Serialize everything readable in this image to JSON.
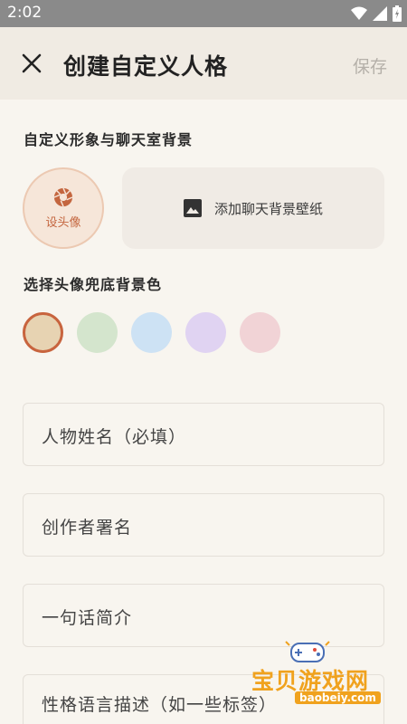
{
  "status_bar": {
    "time": "2:02",
    "icons": [
      "wifi-icon",
      "signal-icon",
      "battery-icon"
    ]
  },
  "app_bar": {
    "close_icon": "close-icon",
    "title": "创建自定义人格",
    "save_label": "保存"
  },
  "appearance": {
    "section_title": "自定义形象与聊天室背景",
    "avatar_label": "设头像",
    "avatar_icon": "camera-aperture-icon",
    "wallpaper_label": "添加聊天背景壁纸",
    "wallpaper_icon": "image-icon"
  },
  "avatar_bg": {
    "section_title": "选择头像兜底背景色",
    "swatches": [
      {
        "color": "#e7d3b2",
        "selected": true
      },
      {
        "color": "#d4e5cd",
        "selected": false
      },
      {
        "color": "#cde2f4",
        "selected": false
      },
      {
        "color": "#e0d3f2",
        "selected": false
      },
      {
        "color": "#f1d3d6",
        "selected": false
      }
    ]
  },
  "form": {
    "name_placeholder": "人物姓名（必填）",
    "author_placeholder": "创作者署名",
    "intro_placeholder": "一句话简介",
    "desc_placeholder": "性格语言描述（如一些标签）"
  },
  "watermark": {
    "text": "宝贝游戏网",
    "url": "baobeiy.com"
  },
  "colors": {
    "accent": "#c8643e",
    "background": "#f8f5ef",
    "app_bar": "#f0ebe3"
  }
}
